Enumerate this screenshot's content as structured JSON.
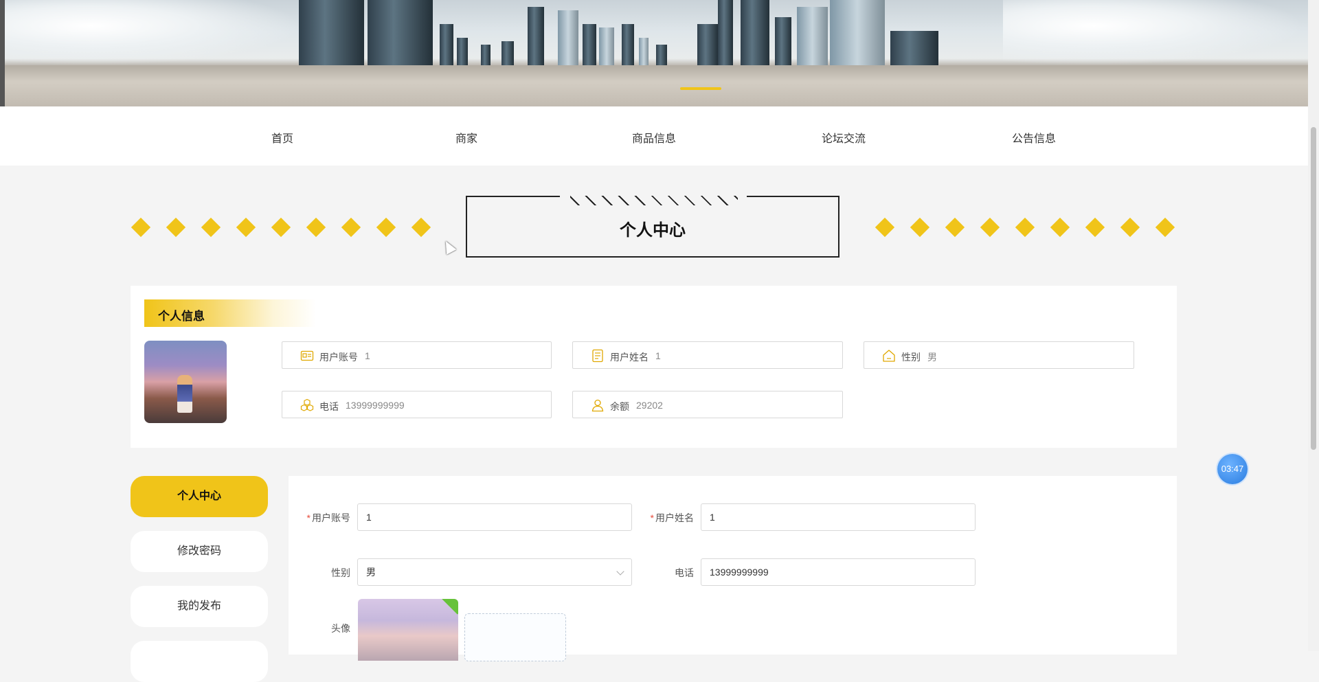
{
  "nav": {
    "items": [
      "首页",
      "商家",
      "商品信息",
      "论坛交流",
      "公告信息"
    ]
  },
  "page_title": "个人中心",
  "info": {
    "header": "个人信息",
    "fields": [
      {
        "label": "用户账号",
        "value": "1",
        "icon": "id-card-icon"
      },
      {
        "label": "用户姓名",
        "value": "1",
        "icon": "document-icon"
      },
      {
        "label": "性别",
        "value": "男",
        "icon": "home-icon"
      },
      {
        "label": "电话",
        "value": "13999999999",
        "icon": "cubes-icon"
      },
      {
        "label": "余额",
        "value": "29202",
        "icon": "user-icon"
      }
    ]
  },
  "sidebar": {
    "items": [
      "个人中心",
      "修改密码",
      "我的发布"
    ],
    "active_index": 0
  },
  "form": {
    "account_label": "用户账号",
    "account_value": "1",
    "name_label": "用户姓名",
    "name_value": "1",
    "gender_label": "性别",
    "gender_value": "男",
    "phone_label": "电话",
    "phone_value": "13999999999",
    "avatar_label": "头像",
    "required_mark": "*"
  },
  "timer": "03:47",
  "colors": {
    "accent": "#f0c419",
    "background": "#f4f4f4",
    "required": "#e74c3c",
    "timer": "#2b7de0"
  }
}
